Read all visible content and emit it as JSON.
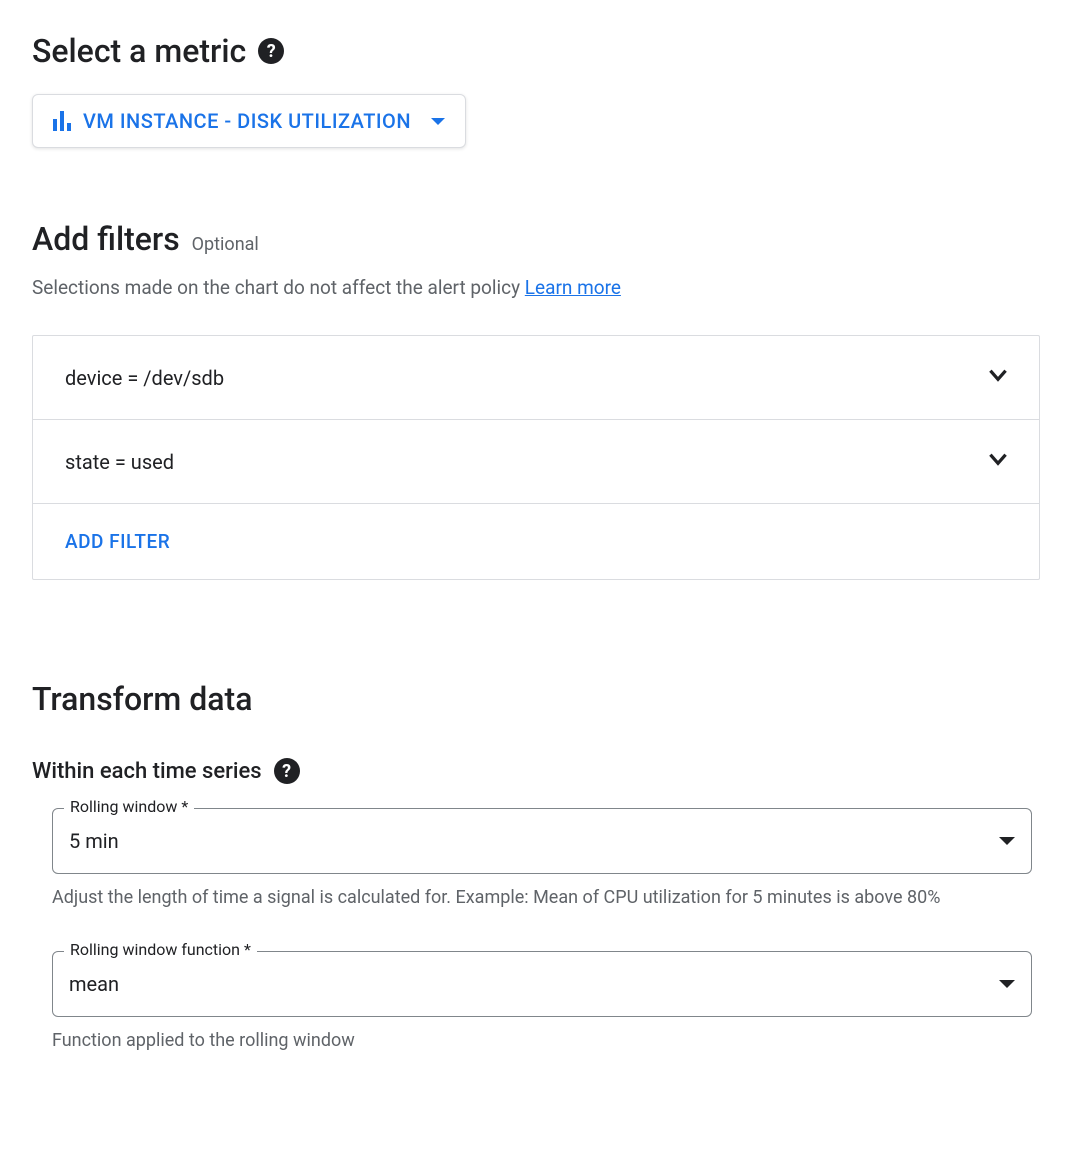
{
  "select_metric": {
    "title": "Select a metric",
    "selected": "VM INSTANCE - DISK UTILIZATION"
  },
  "filters": {
    "title": "Add filters",
    "optional": "Optional",
    "description_prefix": "Selections made on the chart do not affect the alert policy ",
    "learn_more": "Learn more",
    "items": [
      {
        "text": "device = /dev/sdb"
      },
      {
        "text": "state = used"
      }
    ],
    "add_button": "ADD FILTER"
  },
  "transform": {
    "title": "Transform data",
    "subsection": "Within each time series",
    "rolling_window": {
      "label": "Rolling window *",
      "value": "5 min",
      "help": "Adjust the length of time a signal is calculated for. Example: Mean of CPU utilization for 5 minutes is above 80%"
    },
    "rolling_window_function": {
      "label": "Rolling window function *",
      "value": "mean",
      "help": "Function applied to the rolling window"
    }
  }
}
